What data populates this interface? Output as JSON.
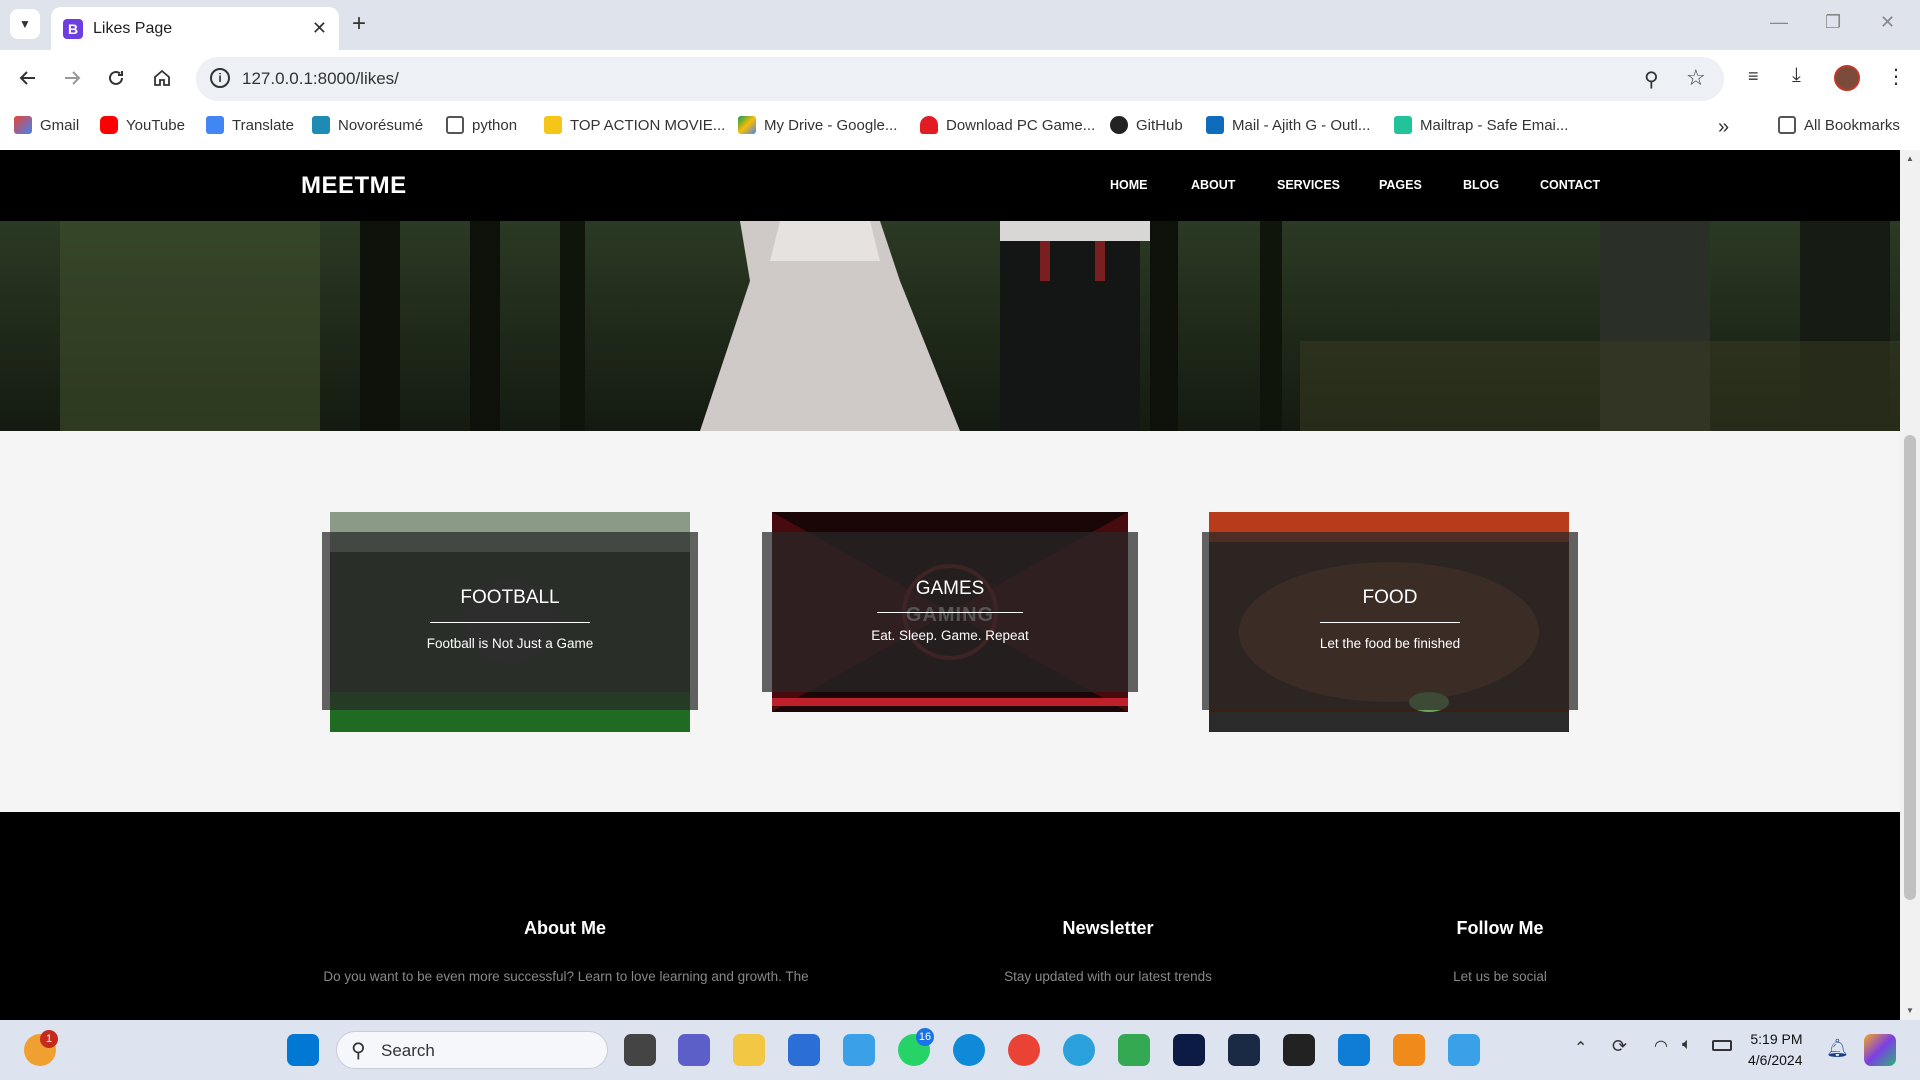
{
  "browser": {
    "tab_title": "Likes Page",
    "url": "127.0.0.1:8000/likes/",
    "bookmarks": [
      "Gmail",
      "YouTube",
      "Translate",
      "Novorésumé",
      "python",
      "TOP ACTION MOVIE...",
      "My Drive - Google...",
      "Download PC Game...",
      "GitHub",
      "Mail - Ajith G - Outl...",
      "Mailtrap - Safe Emai..."
    ],
    "all_bookmarks": "All Bookmarks"
  },
  "site": {
    "brand": "MEETME",
    "menu": [
      "HOME",
      "ABOUT",
      "SERVICES",
      "PAGES",
      "BLOG",
      "CONTACT"
    ]
  },
  "cards": [
    {
      "title": "FOOTBALL",
      "subtitle": "Football is Not Just a Game"
    },
    {
      "title": "GAMES",
      "subtitle": "Eat. Sleep. Game. Repeat",
      "bg_text": "GAMING"
    },
    {
      "title": "FOOD",
      "subtitle": "Let the food be finished"
    }
  ],
  "footer": {
    "about_title": "About Me",
    "about_text": "Do you want to be even more successful? Learn to love learning and growth. The",
    "newsletter_title": "Newsletter",
    "newsletter_text": "Stay updated with our latest trends",
    "follow_title": "Follow Me",
    "follow_text": "Let us be social"
  },
  "taskbar": {
    "search_label": "Search",
    "time": "5:19 PM",
    "date": "4/6/2024",
    "badge_widget": "1",
    "badge_whatsapp": "16"
  },
  "colors": {
    "accent_red": "#c42b1c",
    "nav_black": "#000000",
    "page_bg": "#f5f5f5"
  }
}
